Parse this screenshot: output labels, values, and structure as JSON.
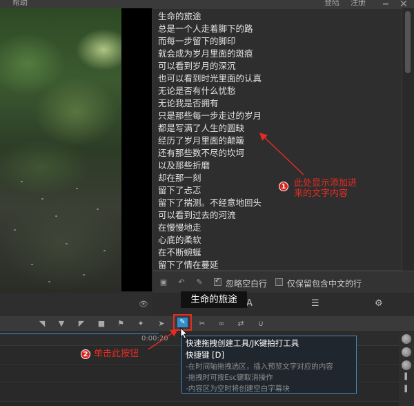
{
  "menu": {
    "help": "帮助",
    "login": "登陆",
    "register": "注册"
  },
  "lyrics": [
    "生命的旅途",
    "总是一个人走着脚下的路",
    "而每一步留下的脚印",
    "就会成为岁月里面的斑痕",
    "可以看到岁月的深沉",
    "也可以看到时光里面的认真",
    "无论是否有什么忧愁",
    "无论我是否拥有",
    "只是那些每一步走过的岁月",
    "都是写满了人生的圆缺",
    "经历了岁月里面的颠簸",
    "还有那些数不尽的坎坷",
    "以及那些折磨",
    "却在那一刻",
    "留下了忐忑",
    "留下了揣测。不经意地回头",
    "可以看到过去的河流",
    "在慢慢地走",
    "心底的柔软",
    "在不断蜿蜒",
    "留下了情在蔓延"
  ],
  "annotation1": {
    "number": "1",
    "text_line1": "此处显示添加进",
    "text_line2": "来的文字内容"
  },
  "annotation2": {
    "number": "2",
    "text": "单击此按钮"
  },
  "lyrics_options": {
    "ignore_blank": "忽略空白行",
    "keep_chinese": "仅保留包含中文的行"
  },
  "current_line_tooltip": "生命的旅途",
  "timeline": {
    "time_label": "0:00:20"
  },
  "tool_tooltip": {
    "title": "快速拖拽创建工具/JK键拍打工具",
    "shortcut": "快捷键 [D]",
    "tip1": "-在时间轴拖拽选区，插入预览文字对应的内容",
    "tip2": "-拖拽时可按Esc键取消操作",
    "tip3": "-内容区为空时将创建空白字幕块"
  },
  "colors": {
    "accent_blue": "#2f8fd0",
    "annotation_red": "#e62c22",
    "tooltip_border": "#3f86c4"
  },
  "icons": {
    "toolbar": [
      "trim-left-icon",
      "marker-down-icon",
      "trim-right-icon",
      "camera-icon",
      "bookmark-icon",
      "magic-wand-icon",
      "pointer-icon",
      "quick-drag-create-icon",
      "scissors-icon",
      "link-icon",
      "swap-icon",
      "magnet-icon"
    ]
  }
}
